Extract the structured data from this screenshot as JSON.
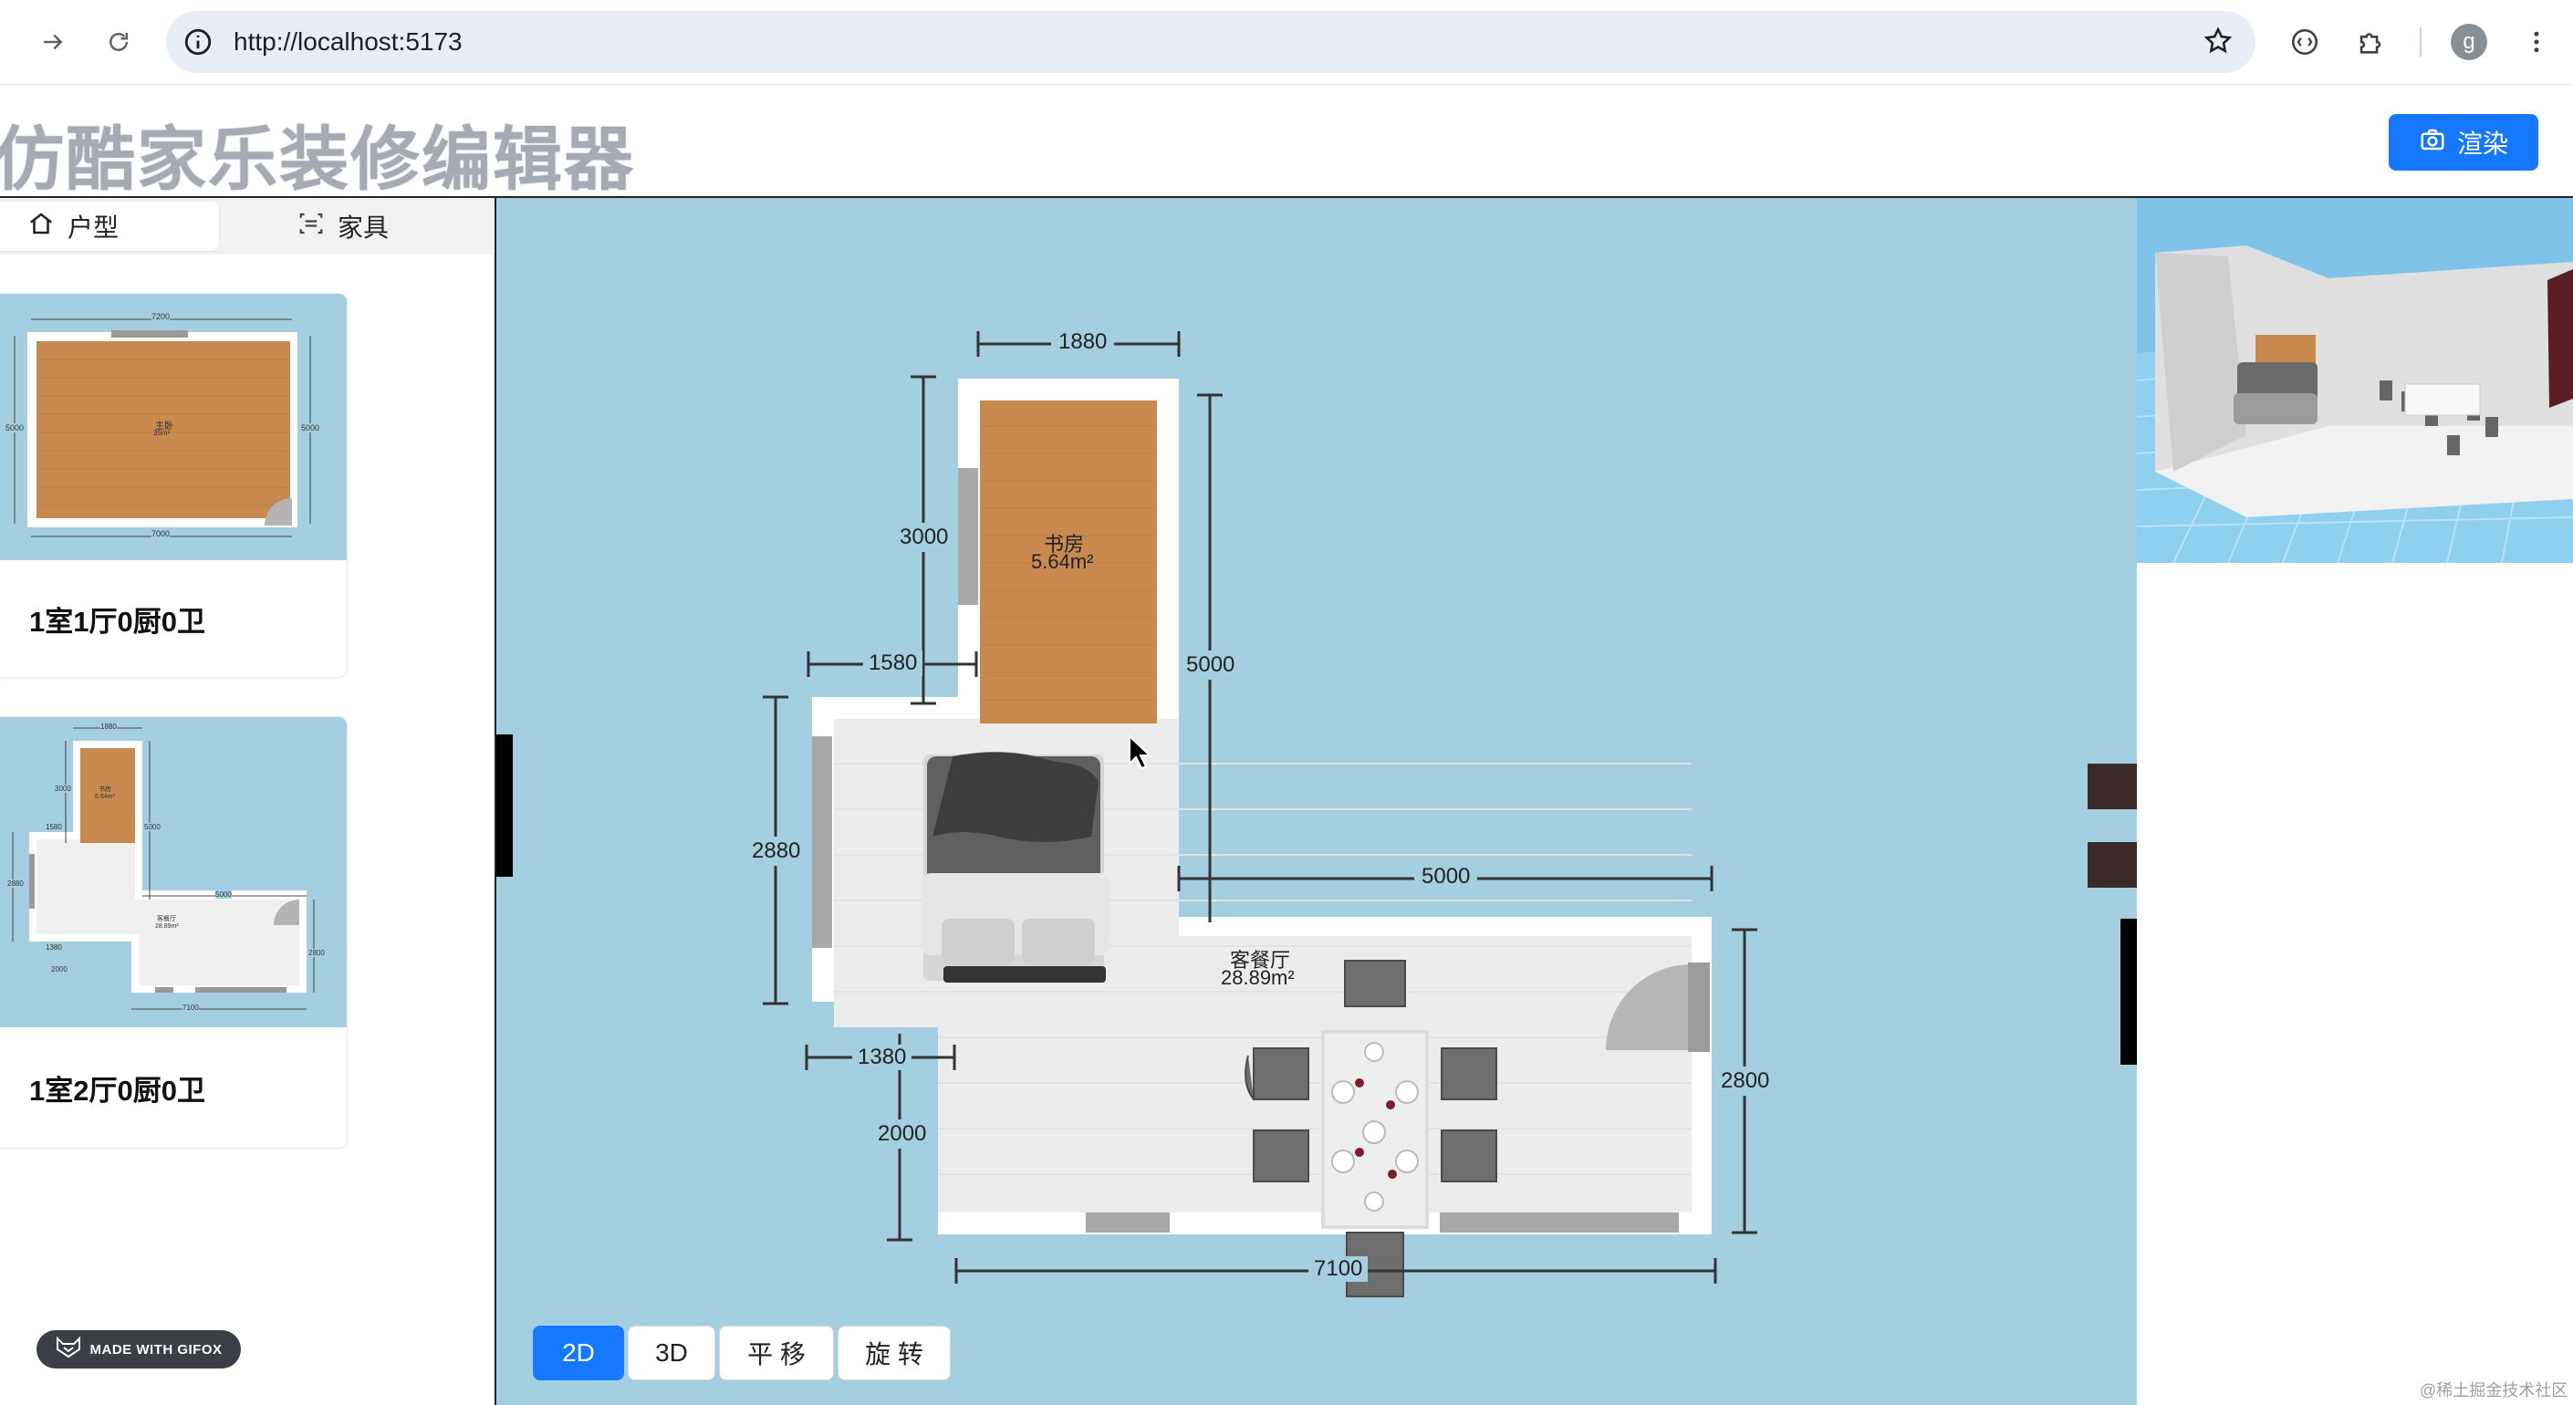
{
  "browser": {
    "url": "http://localhost:5173",
    "profile_initial": "g",
    "icons": [
      "forward-icon",
      "reload-icon",
      "site-info-icon",
      "bookmark-star-icon",
      "extension-devtools-icon",
      "extensions-puzzle-icon",
      "menu-kebab-icon"
    ]
  },
  "app": {
    "title": "仿酷家乐装修编辑器",
    "render_label": "渲染",
    "accent": "#1677ff"
  },
  "sidebar": {
    "tabs": [
      {
        "label": "户型",
        "icon": "home-icon",
        "active": true
      },
      {
        "label": "家具",
        "icon": "furniture-scan-icon",
        "active": false
      }
    ],
    "layouts": [
      {
        "label": "1室1厅0厨0卫",
        "thumb": {
          "top": "7200",
          "bottom": "7000",
          "left": "5000",
          "right": "5000",
          "room_name": "主卧",
          "room_area": "35m²"
        }
      },
      {
        "label": "1室2厅0厨0卫",
        "thumb": {
          "dims": [
            "1880",
            "3000",
            "1580",
            "5000",
            "2880",
            "5000",
            "1380",
            "2000",
            "2800",
            "7100"
          ],
          "room1": "书房",
          "room1_area": "5.64m²",
          "room2": "客餐厅",
          "room2_area": "28.89m²"
        }
      }
    ]
  },
  "plan": {
    "dims": {
      "top_width": "1880",
      "study_height": "3000",
      "offset_left": "1580",
      "study_total": "5000",
      "left_height": "2880",
      "right_width": "5000",
      "bottom_offset": "1380",
      "lower_left": "2000",
      "right_height": "2800",
      "total_width": "7100"
    },
    "rooms": [
      {
        "name": "书房",
        "area": "5.64m²"
      },
      {
        "name": "客餐厅",
        "area": "28.89m²"
      }
    ],
    "bg_color": "#a3cfe0"
  },
  "modes": [
    {
      "label": "2D",
      "active": true
    },
    {
      "label": "3D",
      "active": false
    },
    {
      "label": "平 移",
      "active": false
    },
    {
      "label": "旋 转",
      "active": false
    }
  ],
  "gifox": "MADE WITH GIFOX",
  "watermark": "@稀土掘金技术社区"
}
